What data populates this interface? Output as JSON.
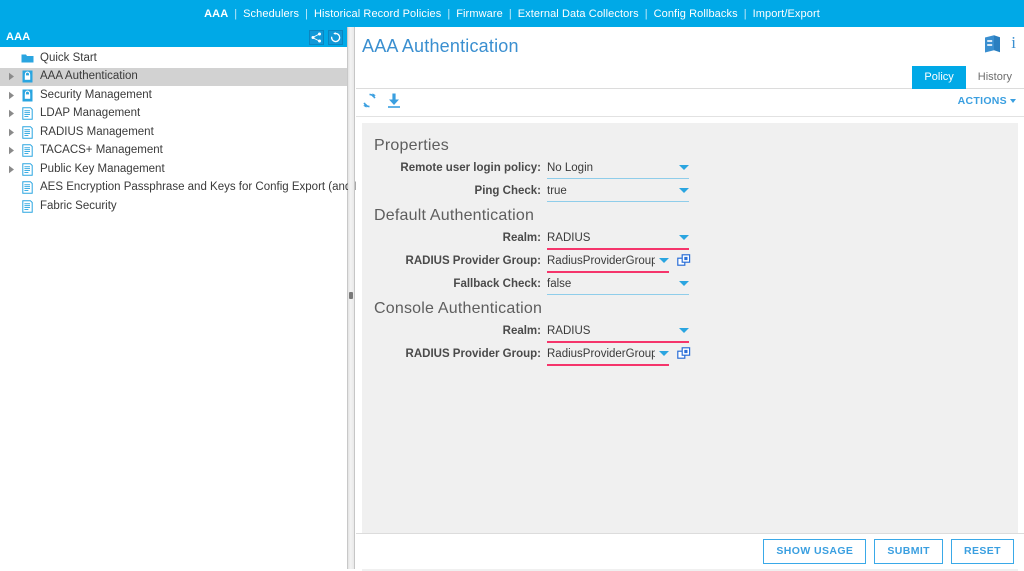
{
  "topnav": {
    "items": [
      {
        "label": "AAA",
        "active": true
      },
      {
        "label": "Schedulers",
        "active": false
      },
      {
        "label": "Historical Record Policies",
        "active": false
      },
      {
        "label": "Firmware",
        "active": false
      },
      {
        "label": "External Data Collectors",
        "active": false
      },
      {
        "label": "Config Rollbacks",
        "active": false
      },
      {
        "label": "Import/Export",
        "active": false
      }
    ],
    "separator": "|"
  },
  "sidebar": {
    "title": "AAA",
    "header_icons": [
      {
        "name": "share-icon"
      },
      {
        "name": "refresh-icon"
      }
    ],
    "tree": [
      {
        "label": "Quick Start",
        "icon": "folder-icon",
        "arrow": false,
        "selected": false
      },
      {
        "label": "AAA Authentication",
        "icon": "lock-icon",
        "arrow": true,
        "selected": true
      },
      {
        "label": "Security Management",
        "icon": "lock-icon",
        "arrow": true,
        "selected": false
      },
      {
        "label": "LDAP Management",
        "icon": "document-icon",
        "arrow": true,
        "selected": false
      },
      {
        "label": "RADIUS Management",
        "icon": "document-icon",
        "arrow": true,
        "selected": false
      },
      {
        "label": "TACACS+ Management",
        "icon": "document-icon",
        "arrow": true,
        "selected": false
      },
      {
        "label": "Public Key Management",
        "icon": "document-icon",
        "arrow": true,
        "selected": false
      },
      {
        "label": "AES Encryption Passphrase and Keys for Config Export (and Import)",
        "icon": "document-icon",
        "arrow": false,
        "selected": false
      },
      {
        "label": "Fabric Security",
        "icon": "document-icon",
        "arrow": false,
        "selected": false
      }
    ]
  },
  "main": {
    "page_title": "AAA Authentication",
    "header_icons": [
      {
        "name": "book-icon"
      },
      {
        "name": "info-icon",
        "glyph": "i"
      }
    ],
    "tabs": [
      {
        "label": "Policy",
        "active": true
      },
      {
        "label": "History",
        "active": false
      }
    ],
    "toolbar": {
      "refresh_icon": "refresh-icon",
      "download_icon": "download-icon",
      "actions_label": "ACTIONS"
    },
    "sections": [
      {
        "title": "Properties",
        "fields": [
          {
            "label": "Remote user login policy:",
            "value": "No Login",
            "modified": false,
            "width": "wide",
            "link": false
          },
          {
            "label": "Ping Check:",
            "value": "true",
            "modified": false,
            "width": "wide",
            "link": false
          }
        ]
      },
      {
        "title": "Default Authentication",
        "fields": [
          {
            "label": "Realm:",
            "value": "RADIUS",
            "modified": true,
            "width": "wide",
            "link": false
          },
          {
            "label": "RADIUS Provider Group:",
            "value": "RadiusProviderGroup",
            "modified": true,
            "width": "narrow",
            "link": true
          },
          {
            "label": "Fallback Check:",
            "value": "false",
            "modified": false,
            "width": "wide",
            "link": false
          }
        ]
      },
      {
        "title": "Console Authentication",
        "fields": [
          {
            "label": "Realm:",
            "value": "RADIUS",
            "modified": true,
            "width": "wide",
            "link": false
          },
          {
            "label": "RADIUS Provider Group:",
            "value": "RadiusProviderGroup",
            "modified": true,
            "width": "narrow",
            "link": true
          }
        ]
      }
    ],
    "footer_buttons": [
      {
        "label": "SHOW USAGE"
      },
      {
        "label": "SUBMIT"
      },
      {
        "label": "RESET"
      }
    ]
  },
  "colors": {
    "brand_blue": "#00a9e7",
    "link_blue": "#3a9fe0",
    "modified_underline": "#f5356b",
    "normal_underline": "#8fcdea",
    "panel_bg": "#f0f0f0"
  }
}
